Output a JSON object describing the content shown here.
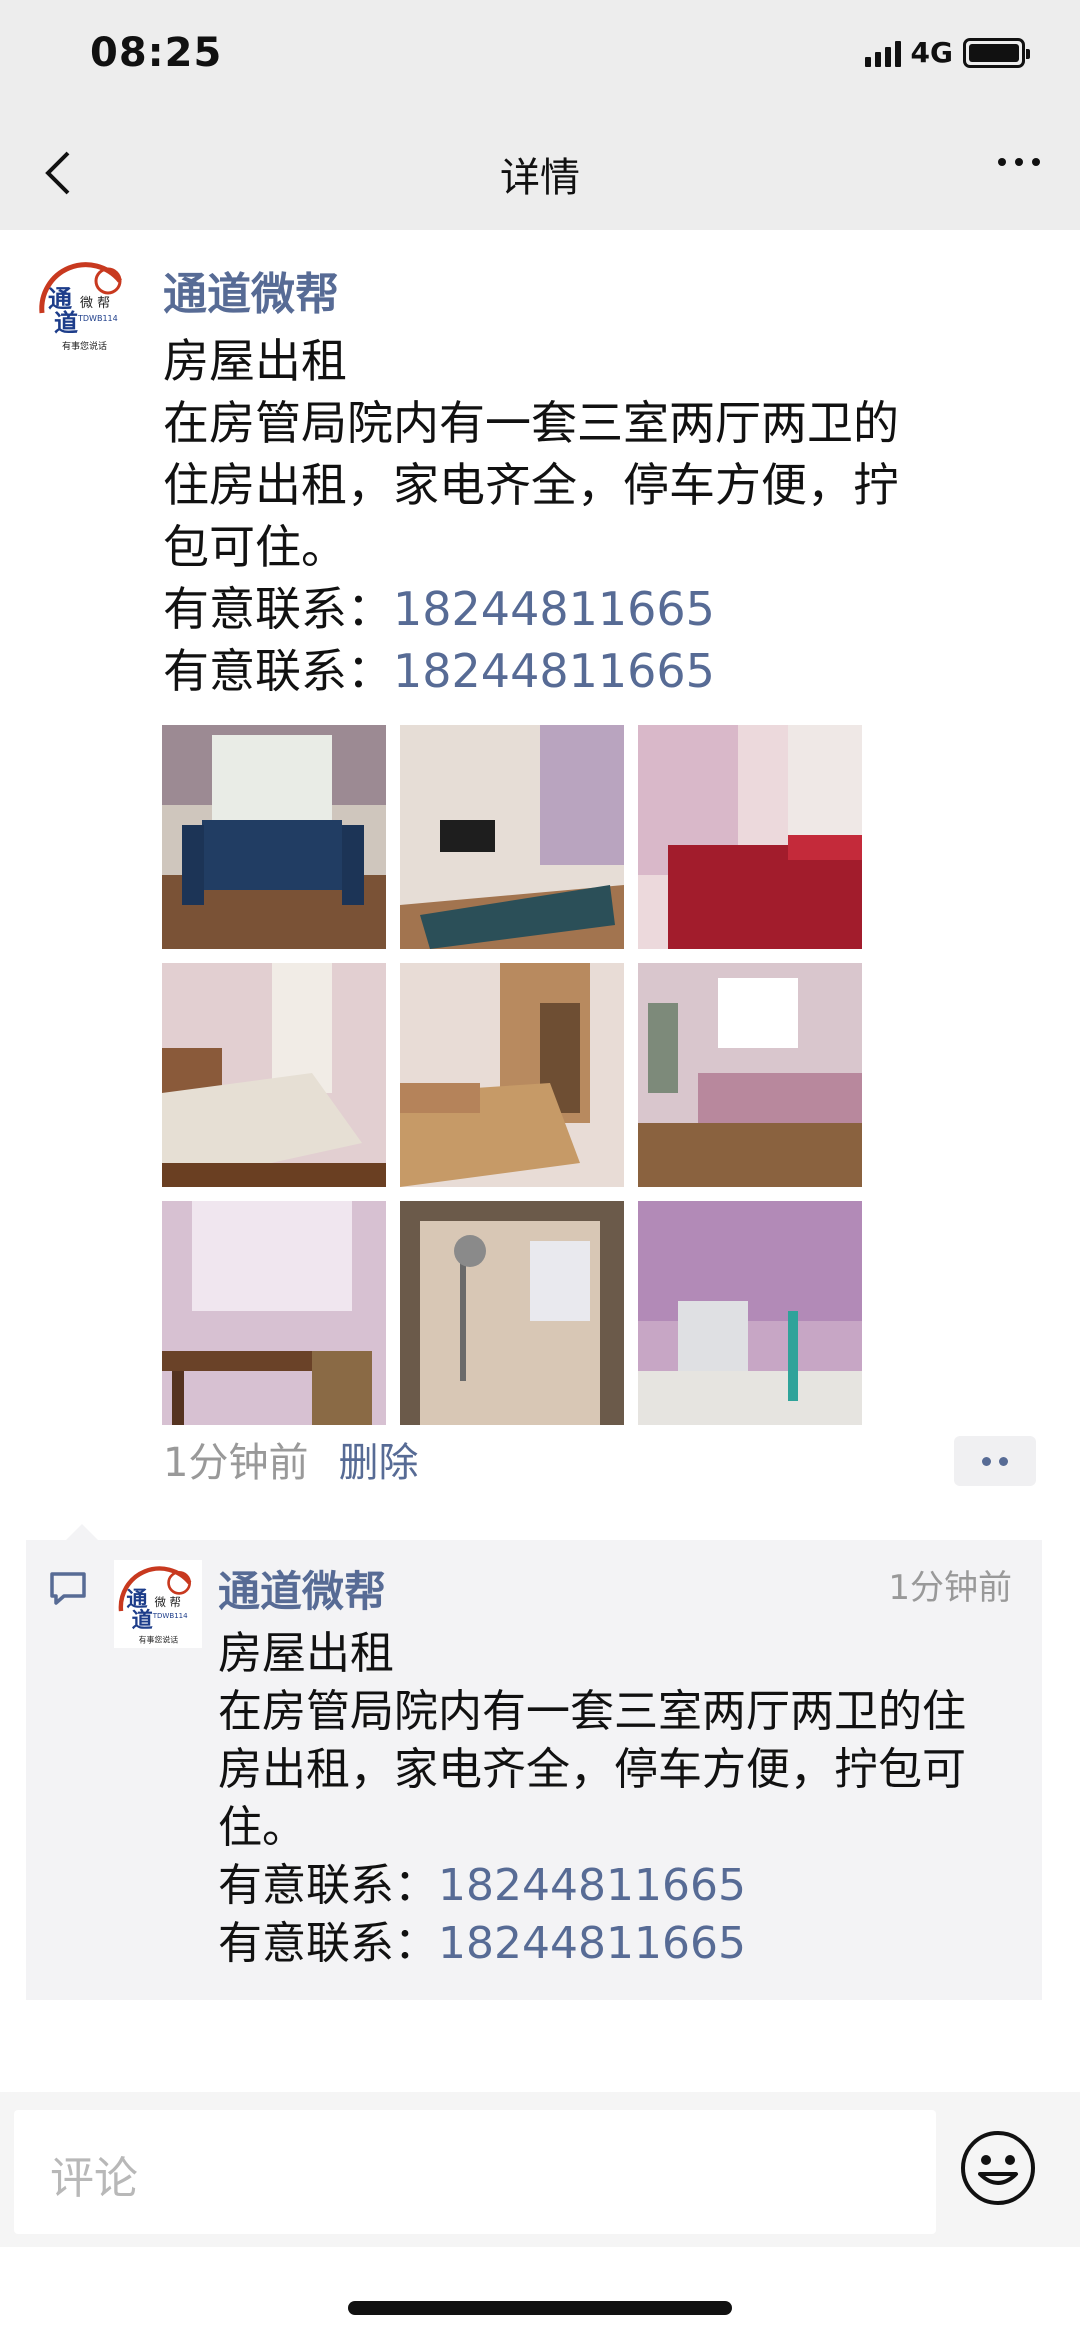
{
  "status": {
    "time": "08:25",
    "network": "4G"
  },
  "nav": {
    "title": "详情",
    "back_icon": "chevron-left-icon",
    "more_icon": "more-dots-icon"
  },
  "post": {
    "author": "通道微帮",
    "avatar_text": {
      "big1": "通",
      "big2": "道",
      "small": "微 帮",
      "code": "TDWB114",
      "slogan": "有事您说话"
    },
    "lines": [
      "房屋出租",
      "在房管局院内有一套三室两厅两卫的",
      "住房出租，家电齐全，停车方便，拧",
      "包可住。"
    ],
    "contacts": [
      {
        "label": "有意联系：",
        "phone": "18244811665"
      },
      {
        "label": "有意联系：",
        "phone": "18244811665"
      }
    ],
    "photos": [
      "dining-room-photo",
      "living-room-photo",
      "bedroom-red-bed-photo",
      "bedroom-window-photo",
      "bedroom-wardrobe-photo",
      "bedroom-bright-photo",
      "desk-window-photo",
      "bathroom-shower-photo",
      "washing-machine-photo"
    ],
    "time": "1分钟前",
    "delete_label": "删除"
  },
  "comment": {
    "author": "通道微帮",
    "time": "1分钟前",
    "lines": [
      "房屋出租",
      "在房管局院内有一套三室两厅两卫的住",
      "房出租，家电齐全，停车方便，拧包可",
      "住。"
    ],
    "contacts": [
      {
        "label": "有意联系：",
        "phone": "18244811665"
      },
      {
        "label": "有意联系：",
        "phone": "18244811665"
      }
    ]
  },
  "input": {
    "placeholder": "评论",
    "emoji_icon": "emoji-icon"
  },
  "colors": {
    "link": "#576b95",
    "muted": "#999999",
    "nav_bg": "#ededed",
    "comment_bg": "#f3f3f5"
  }
}
